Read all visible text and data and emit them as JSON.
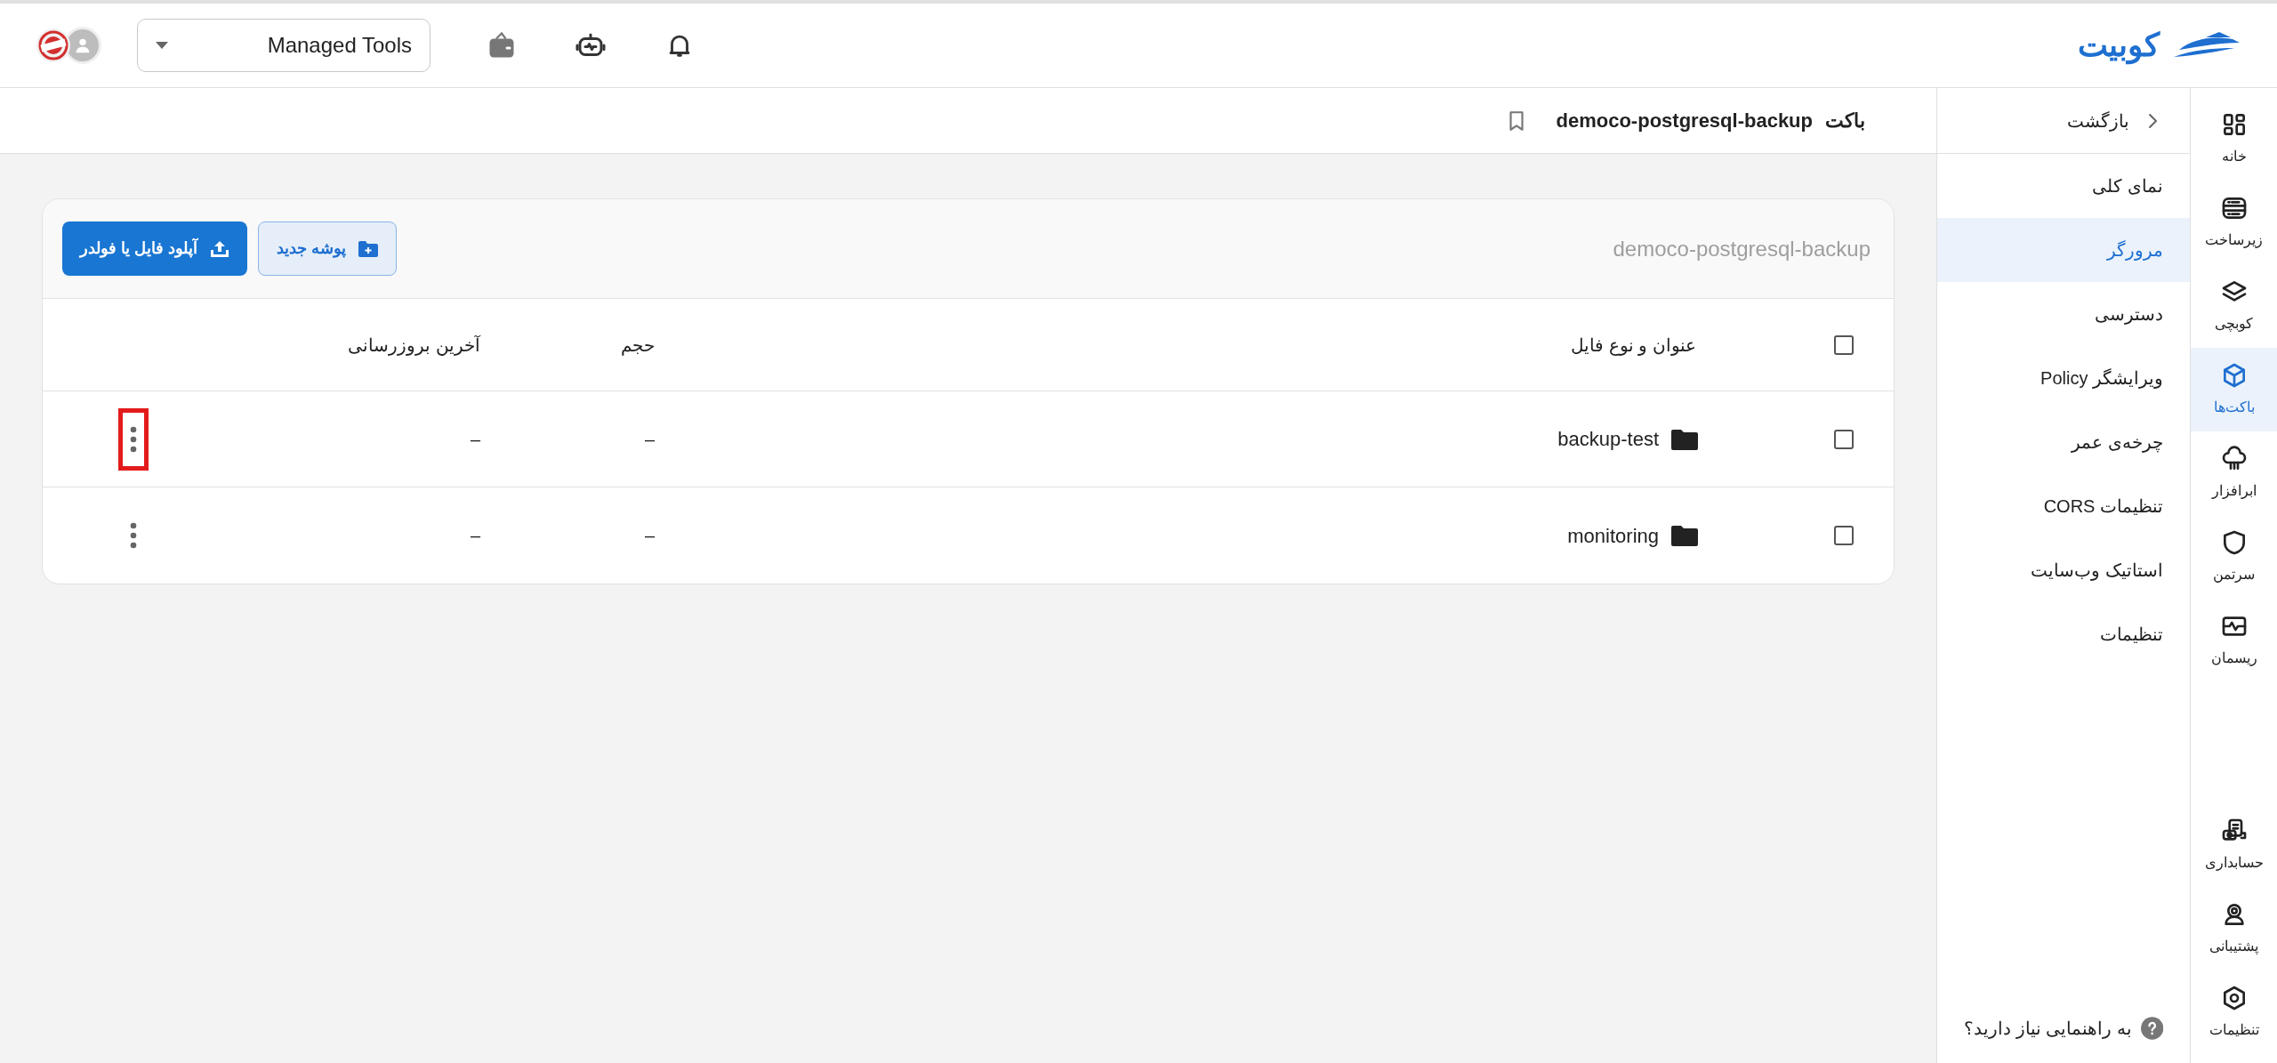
{
  "header": {
    "logo": "کوبیت",
    "project_select": {
      "value": "Managed Tools"
    }
  },
  "rail": {
    "items": [
      {
        "label": "خانه",
        "kind": "grid",
        "selected": false
      },
      {
        "label": "زیرساخت",
        "kind": "server",
        "selected": false
      },
      {
        "label": "کوبچی",
        "kind": "layers",
        "selected": false
      },
      {
        "label": "باکت‌ها",
        "kind": "cube",
        "selected": true
      },
      {
        "label": "ابرافزار",
        "kind": "cloud",
        "selected": false
      },
      {
        "label": "سرتمن",
        "kind": "shield",
        "selected": false
      },
      {
        "label": "ریسمان",
        "kind": "pulse",
        "selected": false
      }
    ],
    "bottom_items": [
      {
        "label": "حسابداری",
        "kind": "billing",
        "selected": false
      },
      {
        "label": "پشتیبانی",
        "kind": "support",
        "selected": false
      },
      {
        "label": "تنظیمات",
        "kind": "hex",
        "selected": false
      }
    ]
  },
  "sidebar": {
    "back": "بازگشت",
    "items": [
      {
        "label": "نمای کلی",
        "selected": false
      },
      {
        "label": "مرورگر",
        "selected": true
      },
      {
        "label": "دسترسی",
        "selected": false
      },
      {
        "label": "ویرایشگر Policy",
        "selected": false
      },
      {
        "label": "چرخه‌ی عمر",
        "selected": false
      },
      {
        "label": "تنظیمات CORS",
        "selected": false
      },
      {
        "label": "استاتیک وب‌سایت",
        "selected": false
      },
      {
        "label": "تنظیمات",
        "selected": false
      }
    ],
    "help": "به راهنمایی نیاز دارید؟"
  },
  "breadcrumb": {
    "label": "باکت",
    "name": "democo-postgresql-backup"
  },
  "browser": {
    "path": "democo-postgresql-backup",
    "new_folder": "پوشه جدید",
    "upload": "آپلود فایل یا فولدر",
    "columns": [
      "عنوان و نوع فایل",
      "حجم",
      "آخرین بروزرسانی"
    ],
    "select_all": {
      "checked": false
    },
    "rows": [
      {
        "name": "backup-test",
        "kind": "folder",
        "size": "–",
        "updated": "–",
        "checked": false,
        "highlighted": true
      },
      {
        "name": "monitoring",
        "kind": "folder",
        "size": "–",
        "updated": "–",
        "checked": false,
        "highlighted": false
      }
    ]
  }
}
